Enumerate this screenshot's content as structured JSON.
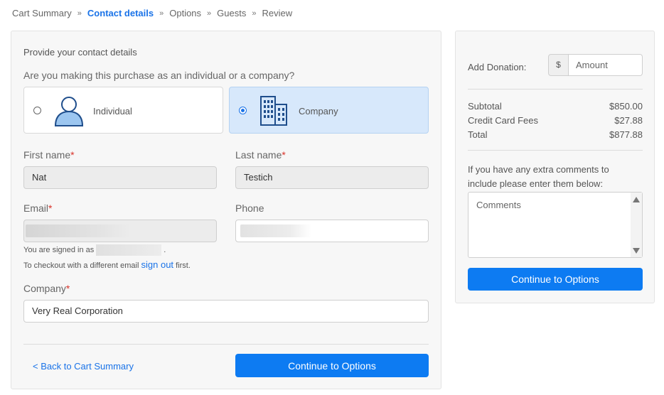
{
  "breadcrumb": {
    "items": [
      "Cart Summary",
      "Contact details",
      "Options",
      "Guests",
      "Review"
    ],
    "separator": "»",
    "active_index": 1
  },
  "form": {
    "title": "Provide your contact details",
    "question": "Are you making this purchase as an individual or a company?",
    "choices": {
      "individual": {
        "label": "Individual",
        "icon": "person-icon",
        "selected": false
      },
      "company": {
        "label": "Company",
        "icon": "building-icon",
        "selected": true
      }
    },
    "first_name": {
      "label": "First name",
      "value": "Nat"
    },
    "last_name": {
      "label": "Last name",
      "value": "Testich"
    },
    "email": {
      "label": "Email",
      "value": ""
    },
    "phone": {
      "label": "Phone",
      "value": ""
    },
    "required_mark": "*",
    "signed_in_prefix": "You are signed in as",
    "signed_in_suffix": ".",
    "checkout_note_prefix": "To checkout with a different email",
    "sign_out_link": "sign out",
    "checkout_note_suffix": "first.",
    "company": {
      "label": "Company",
      "value": "Very Real Corporation"
    },
    "back_link": "< Back to Cart Summary",
    "continue_button": "Continue to Options"
  },
  "sidebar": {
    "donation_label": "Add Donation:",
    "currency_symbol": "$",
    "amount_placeholder": "Amount",
    "subtotal_label": "Subtotal",
    "subtotal_value": "$850.00",
    "fees_label": "Credit Card Fees",
    "fees_value": "$27.88",
    "total_label": "Total",
    "total_value": "$877.88",
    "comments_help": "If you have any extra comments to include please enter them below:",
    "comments_placeholder": "Comments",
    "continue_button": "Continue to Options"
  },
  "colors": {
    "accent": "#0d7bf2",
    "selected_bg": "#d7e8fb",
    "required": "#d9342b"
  }
}
